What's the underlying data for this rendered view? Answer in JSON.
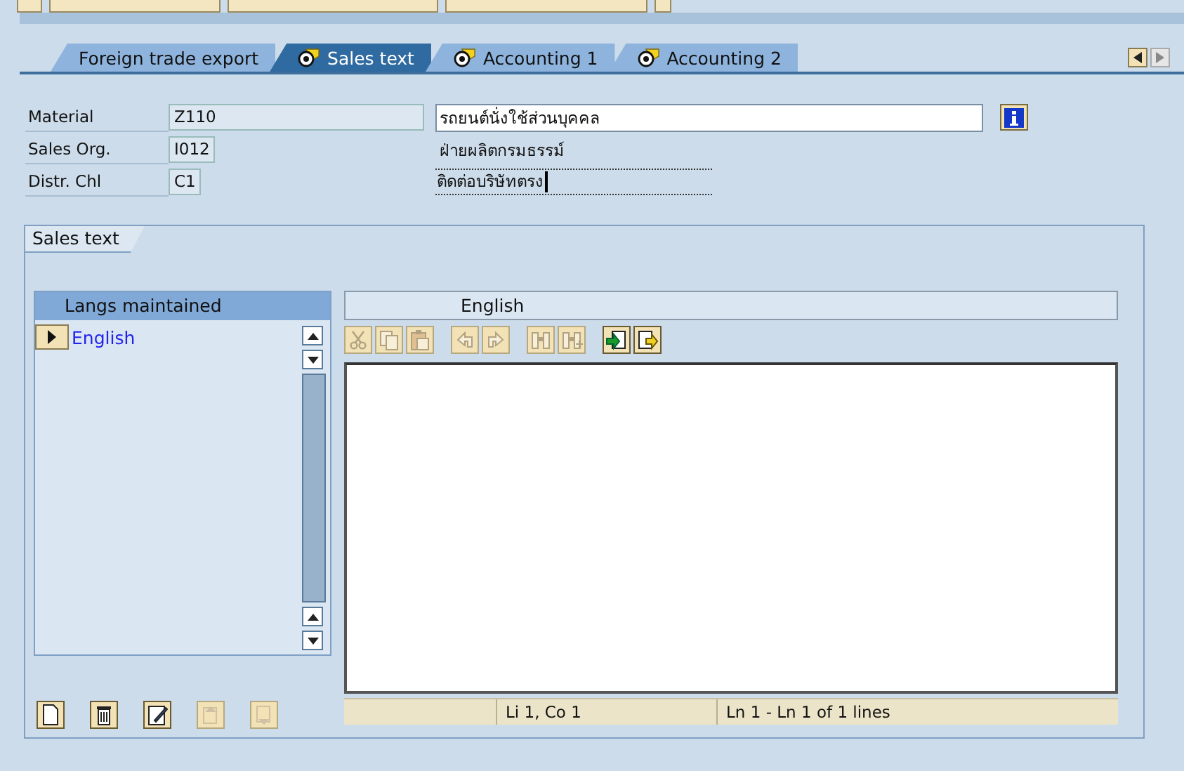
{
  "tabs": [
    {
      "label": "Foreign trade export",
      "selected": false,
      "icon": false
    },
    {
      "label": "Sales text",
      "selected": true,
      "icon": true
    },
    {
      "label": "Accounting 1",
      "selected": false,
      "icon": true
    },
    {
      "label": "Accounting 2",
      "selected": false,
      "icon": true
    }
  ],
  "fields": [
    {
      "label": "Material",
      "value": "Z110",
      "description": "รถยนต์นั่งใช้ส่วนบุคคล",
      "kind": "input",
      "info_button": true,
      "cursor": false
    },
    {
      "label": "Sales Org.",
      "value": "I012",
      "description": "ฝ่ายผลิตกรมธรรม์",
      "kind": "text",
      "info_button": false,
      "cursor": false
    },
    {
      "label": "Distr. Chl",
      "value": "C1",
      "description": "ติดต่อบริษัทตรง",
      "kind": "editable",
      "info_button": false,
      "cursor": true
    }
  ],
  "group": {
    "title": "Sales text",
    "languages": {
      "header": "Langs maintained",
      "items": [
        {
          "label": "English",
          "selected": true
        }
      ]
    },
    "editor": {
      "header": "English",
      "toolbar": [
        {
          "kind": "cut",
          "disabled": true
        },
        {
          "kind": "copy",
          "disabled": true
        },
        {
          "kind": "paste",
          "disabled": true
        },
        {
          "kind": "undo",
          "disabled": true
        },
        {
          "kind": "redo",
          "disabled": true
        },
        {
          "kind": "find",
          "disabled": true
        },
        {
          "kind": "find-next",
          "disabled": true
        },
        {
          "kind": "import",
          "disabled": false
        },
        {
          "kind": "export",
          "disabled": false
        }
      ],
      "status": [
        "Li 1, Co 1",
        "Ln 1 - Ln 1 of 1 lines"
      ]
    },
    "buttons": [
      {
        "kind": "new",
        "disabled": false
      },
      {
        "kind": "delete",
        "disabled": false
      },
      {
        "kind": "edit",
        "disabled": false
      },
      {
        "kind": "move-up",
        "disabled": true
      },
      {
        "kind": "move-down",
        "disabled": true
      }
    ]
  }
}
